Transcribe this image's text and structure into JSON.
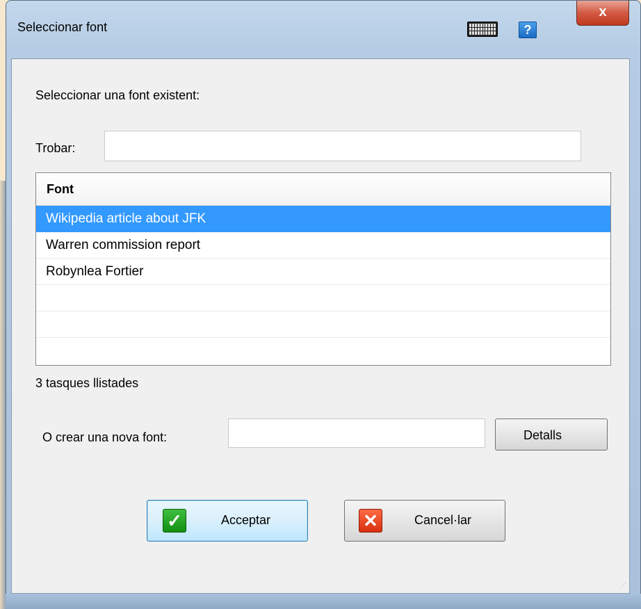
{
  "window": {
    "title": "Seleccionar font",
    "close_label": "x",
    "help_label": "?"
  },
  "icons": {
    "keyboard": "keyboard-icon",
    "help": "help-icon",
    "close": "close-icon",
    "ok": "checkmark-icon",
    "cancel": "x-icon"
  },
  "main": {
    "instruction": "Seleccionar una font existent:",
    "search_label": "Trobar:",
    "search_value": "",
    "list": {
      "header": "Font",
      "rows": [
        "Wikipedia article about JFK",
        "Warren commission report",
        "Robynlea Fortier",
        "",
        "",
        ""
      ],
      "selected_index": 0
    },
    "count_text": "3 tasques llistades",
    "new_label": "O crear una nova font:",
    "new_value": "",
    "details_button": "Detalls",
    "accept_button": "Acceptar",
    "cancel_button": "Cancel·lar"
  },
  "colors": {
    "selection": "#3399ff",
    "ok_icon": "#2aa52a",
    "cancel_icon": "#e84a26"
  }
}
